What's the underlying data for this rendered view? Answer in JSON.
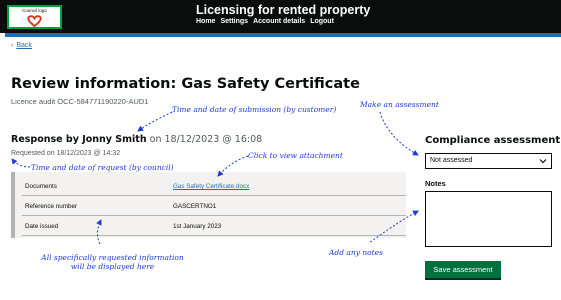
{
  "header": {
    "logo_text": "Council logo",
    "title": "Licensing for rented property",
    "nav": [
      "Home",
      "Settings",
      "Account details",
      "Logout"
    ]
  },
  "back_link": "Back",
  "page": {
    "title": "Review information: Gas Safety Certificate",
    "caption": "Licence audit OCC-584771190220-AUD1"
  },
  "response": {
    "by": "Response by Jonny Smith",
    "on": "on 18/12/2023 @ 16:08",
    "requested": "Requested on 18/12/2023 @ 14:32"
  },
  "details": [
    {
      "key": "Documents",
      "value": "Gas Safety Certificate.docx"
    },
    {
      "key": "Reference number",
      "value": "GASCERTNO1"
    },
    {
      "key": "Date issued",
      "value": "1st January 2023"
    }
  ],
  "compliance": {
    "title": "Compliance assessment",
    "selected": "Not assessed",
    "notes_label": "Notes",
    "save_label": "Save assessment"
  },
  "annotations": {
    "submission": "Time and date of submission (by customer)",
    "make_assessment": "Make an assessment",
    "request": "Time and date of request (by council)",
    "attachment": "Click to view attachment",
    "requested_info_1": "All specifically requested information",
    "requested_info_2": "will be displayed here",
    "add_notes": "Add any notes"
  },
  "colors": {
    "header_bg": "#0b0c0c",
    "accent_blue": "#1d70b8",
    "button_green": "#00703c",
    "annotation_blue": "#1d3bcf"
  }
}
